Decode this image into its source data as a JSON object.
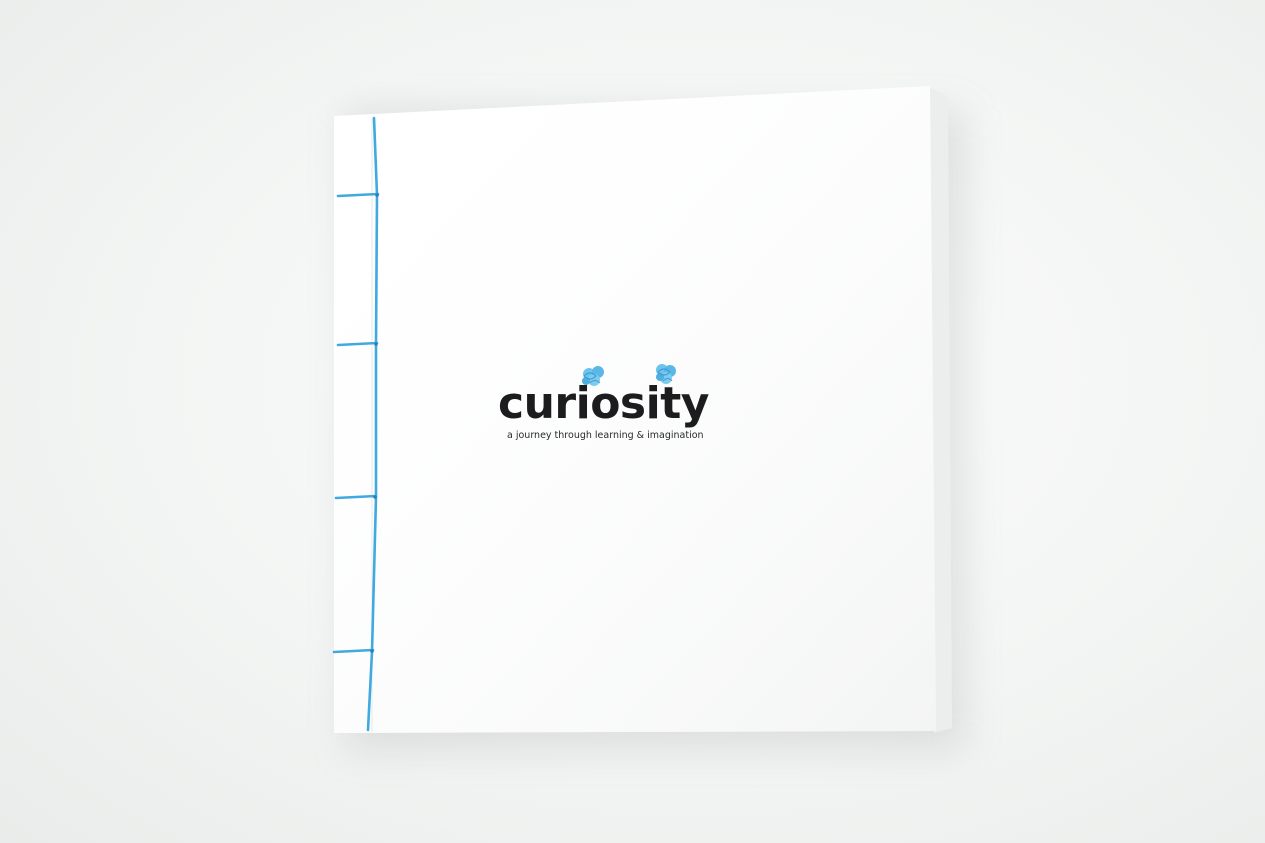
{
  "book_cover": {
    "title": "curiosity",
    "subtitle": "a journey through learning & imagination"
  },
  "colors": {
    "cover": "#ffffff",
    "title_text": "#1c1c1e",
    "subtitle_text": "#2a2a2e",
    "binding_thread": "#3fa9e0",
    "knot": "#6cc3ee"
  }
}
